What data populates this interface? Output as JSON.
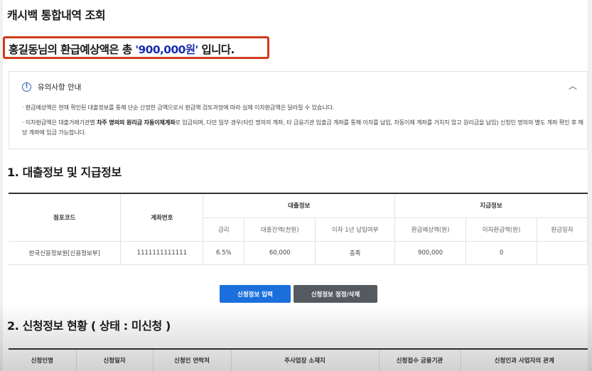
{
  "page_title": "캐시백 통합내역 조회",
  "summary": {
    "prefix": "홍길동님의 환급예상액은 총 ",
    "amount": "'900,000원'",
    "suffix": " 입니다."
  },
  "notice": {
    "title": "유의사항 안내",
    "toggle": "︿",
    "item1": "· 환급예상액은 현재 확인된 대출정보를 통해 단순 산정한 금액으로서 환급액 검토과정에 따라 실제 이자환급액은 달라질 수 있습니다.",
    "item2_a": "· 이자환급액은 대출거래기관별 ",
    "item2_bold": "차주 명의의 원리금 자동이체계좌",
    "item2_b": "로 입금되며, 다만 일부 경우(타인 명의의 계좌, 타 금융기관 입출금 계좌를 통해 이자를 납입, 자동이체 계좌를 거치지 않고 원리금을 납입) 신청인 명의의 별도 계좌 확인 후 해당 계좌에 입금 가능합니다."
  },
  "section1": {
    "title": "1. 대출정보 및 지급정보",
    "table": {
      "col_branch": "점포코드",
      "col_account": "계좌번호",
      "group_loan": "대출정보",
      "group_payment": "지급정보",
      "sub_headers": [
        "금리",
        "대출잔액(천원)",
        "이자 1년 납입여부",
        "환급예상액(원)",
        "이자환급액(원)",
        "환급일자"
      ],
      "row": {
        "branch": "한국신용정보원[신용정보부]",
        "account": "1111111111111",
        "cells": [
          "6.5%",
          "60,000",
          "충족",
          "900,000",
          "0",
          ""
        ]
      }
    }
  },
  "buttons": {
    "enter": "신청정보 입력",
    "edit": "신청정보 정정/삭제"
  },
  "section2": {
    "title": "2. 신청정보 현황 ( 상태 : 미신청 )",
    "headers": [
      "신청인명",
      "신청일자",
      "신청인 연락처",
      "주사업장 소재지",
      "신청접수 금융기관",
      "신청인과 사업자의 관계"
    ]
  },
  "colors": {
    "highlight_border": "#d03a1e",
    "amount_text": "#1b2eb0",
    "primary_button": "#1a6fdc",
    "secondary_button": "#555a60"
  }
}
